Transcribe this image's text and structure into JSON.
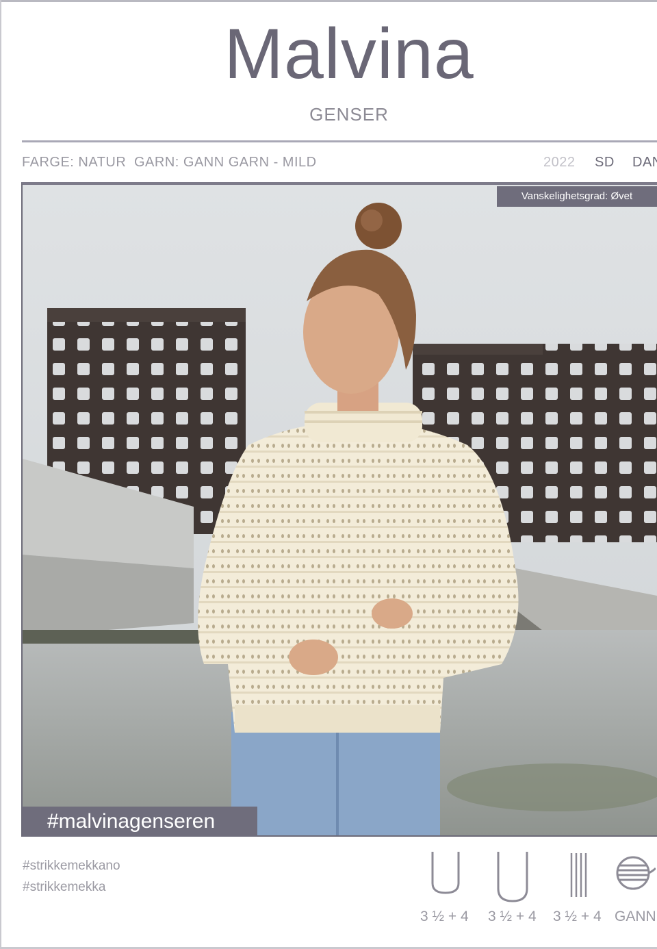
{
  "header": {
    "title": "Malvina",
    "subtitle": "GENSER"
  },
  "meta": {
    "color": "FARGE: NATUR",
    "yarn": "GARN: GANN GARN - MILD",
    "year": "2022",
    "lang1": "SD",
    "lang2": "DAN"
  },
  "photo": {
    "difficulty": "Vanskelighetsgrad: Øvet",
    "hashtag": "#malvinagenseren"
  },
  "footer": {
    "tags": [
      "#strikkemekkano",
      "#strikkemekka"
    ],
    "tools": [
      {
        "icon": "circular-needle-icon",
        "label": "3 ½ + 4"
      },
      {
        "icon": "circular-needle-icon",
        "label": "3 ½ + 4"
      },
      {
        "icon": "double-pointed-needles-icon",
        "label": "3 ½ + 4"
      },
      {
        "icon": "yarn-ball-icon",
        "label": "GANN"
      }
    ]
  },
  "colors": {
    "accent": "#6f6d7c",
    "text_light": "#9a99a2",
    "sweater": "#f3ecd9",
    "jeans": "#8aa6c8"
  }
}
